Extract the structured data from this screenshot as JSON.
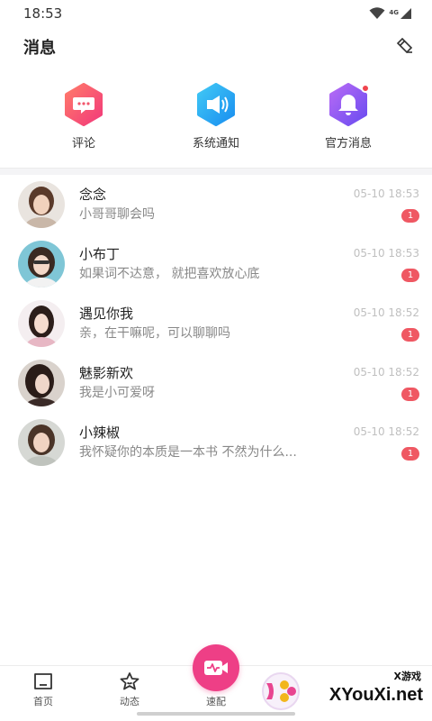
{
  "status_bar": {
    "time": "18:53",
    "network": "4G"
  },
  "header": {
    "title": "消息",
    "clear_icon": "eraser-icon"
  },
  "quick_actions": [
    {
      "label": "评论",
      "icon": "comment-icon",
      "color": "#f2566c"
    },
    {
      "label": "系统通知",
      "icon": "speaker-icon",
      "color": "#1fa8f0"
    },
    {
      "label": "官方消息",
      "icon": "bell-icon",
      "color": "#8a5cf2"
    }
  ],
  "messages": [
    {
      "name": "念念",
      "preview": "小哥哥聊会吗",
      "time": "05-10 18:53",
      "unread": "1"
    },
    {
      "name": "小布丁",
      "preview": "如果词不达意， 就把喜欢放心底",
      "time": "05-10 18:53",
      "unread": "1"
    },
    {
      "name": "遇见你我",
      "preview": "亲，在干嘛呢，可以聊聊吗",
      "time": "05-10 18:52",
      "unread": "1"
    },
    {
      "name": "魅影新欢",
      "preview": "我是小可爱呀",
      "time": "05-10 18:52",
      "unread": "1"
    },
    {
      "name": "小辣椒",
      "preview": "我怀疑你的本质是一本书 不然为什么...",
      "time": "05-10 18:52",
      "unread": "1"
    }
  ],
  "tab_bar": {
    "tabs": [
      {
        "label": "首页",
        "icon": "home-icon"
      },
      {
        "label": "动态",
        "icon": "star-icon"
      },
      {
        "label": "速配",
        "icon": "video-match-icon"
      }
    ],
    "accent": "#ee3f86"
  },
  "watermark": {
    "small": "X游戏",
    "big": "XYouXi.net"
  }
}
